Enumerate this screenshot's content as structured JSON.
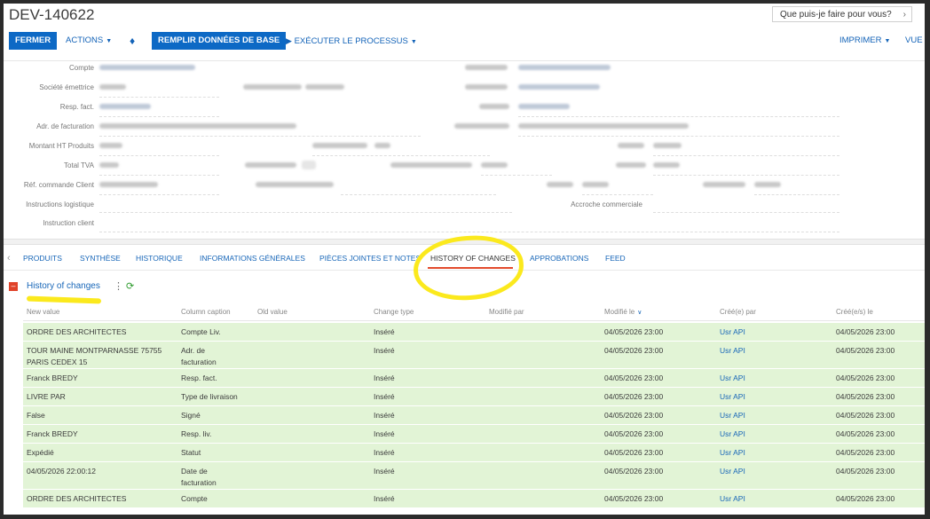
{
  "header": {
    "title": "DEV-140622",
    "help_placeholder": "Que puis-je faire pour vous?"
  },
  "toolbar": {
    "close": "FERMER",
    "actions": "ACTIONS",
    "fill_data": "REMPLIR DONNÉES DE BASE",
    "run_process": "EXÉCUTER LE PROCESSUS",
    "print": "IMPRIMER",
    "view": "VUE"
  },
  "form": {
    "labels": {
      "compte": "Compte",
      "societe": "Société émettrice",
      "resp_fact": "Resp. fact.",
      "adr_fact": "Adr. de facturation",
      "montant_ht": "Montant HT Produits",
      "total_tva": "Total TVA",
      "ref_cmd": "Réf. commande Client",
      "instr_log": "Instructions logistique",
      "instr_client": "Instruction client",
      "accroche": "Accroche commerciale"
    }
  },
  "tabs": [
    "PRODUITS",
    "SYNTHÈSE",
    "HISTORIQUE",
    "INFORMATIONS GÉNÉRALES",
    "PIÈCES JOINTES ET NOTES",
    "HISTORY OF CHANGES",
    "APPROBATIONS",
    "FEED"
  ],
  "active_tab": "HISTORY OF CHANGES",
  "section": {
    "title": "History of changes"
  },
  "grid": {
    "columns": [
      "New value",
      "Column caption",
      "Old value",
      "Change type",
      "Modifié par",
      "Modifié le",
      "Créé(e) par",
      "Créé(e/s) le"
    ],
    "rows": [
      {
        "new_value": "ORDRE DES ARCHITECTES",
        "new_value2": "",
        "caption": "Compte Liv.",
        "caption2": "",
        "change_type": "Inséré",
        "modified_on": "04/05/2026 23:00",
        "created_by": "Usr API",
        "created_on": "04/05/2026 23:00"
      },
      {
        "new_value": "TOUR MAINE MONTPARNASSE 75755",
        "new_value2": "PARIS CEDEX 15",
        "caption": "Adr. de",
        "caption2": "facturation",
        "change_type": "Inséré",
        "modified_on": "04/05/2026 23:00",
        "created_by": "Usr API",
        "created_on": "04/05/2026 23:00"
      },
      {
        "new_value": "Franck BREDY",
        "new_value2": "",
        "caption": "Resp. fact.",
        "caption2": "",
        "change_type": "Inséré",
        "modified_on": "04/05/2026 23:00",
        "created_by": "Usr API",
        "created_on": "04/05/2026 23:00"
      },
      {
        "new_value": "LIVRE PAR",
        "new_value2": "",
        "caption": "Type de livraison",
        "caption2": "",
        "change_type": "Inséré",
        "modified_on": "04/05/2026 23:00",
        "created_by": "Usr API",
        "created_on": "04/05/2026 23:00"
      },
      {
        "new_value": "False",
        "new_value2": "",
        "caption": "Signé",
        "caption2": "",
        "change_type": "Inséré",
        "modified_on": "04/05/2026 23:00",
        "created_by": "Usr API",
        "created_on": "04/05/2026 23:00"
      },
      {
        "new_value": "Franck BREDY",
        "new_value2": "",
        "caption": "Resp. liv.",
        "caption2": "",
        "change_type": "Inséré",
        "modified_on": "04/05/2026 23:00",
        "created_by": "Usr API",
        "created_on": "04/05/2026 23:00"
      },
      {
        "new_value": "Expédié",
        "new_value2": "",
        "caption": "Statut",
        "caption2": "",
        "change_type": "Inséré",
        "modified_on": "04/05/2026 23:00",
        "created_by": "Usr API",
        "created_on": "04/05/2026 23:00"
      },
      {
        "new_value": "04/05/2026 22:00:12",
        "new_value2": "",
        "caption": "Date de",
        "caption2": "facturation",
        "change_type": "Inséré",
        "modified_on": "04/05/2026 23:00",
        "created_by": "Usr API",
        "created_on": "04/05/2026 23:00"
      },
      {
        "new_value": "ORDRE DES ARCHITECTES",
        "new_value2": "",
        "caption": "Compte",
        "caption2": "",
        "change_type": "Inséré",
        "modified_on": "04/05/2026 23:00",
        "created_by": "Usr API",
        "created_on": "04/05/2026 23:00"
      }
    ]
  },
  "colors": {
    "primary": "#0d69c5",
    "link": "#1766b8",
    "row_bg": "#e2f4d6",
    "highlight": "#fbe91d",
    "tab_underline": "#e34b2c"
  }
}
